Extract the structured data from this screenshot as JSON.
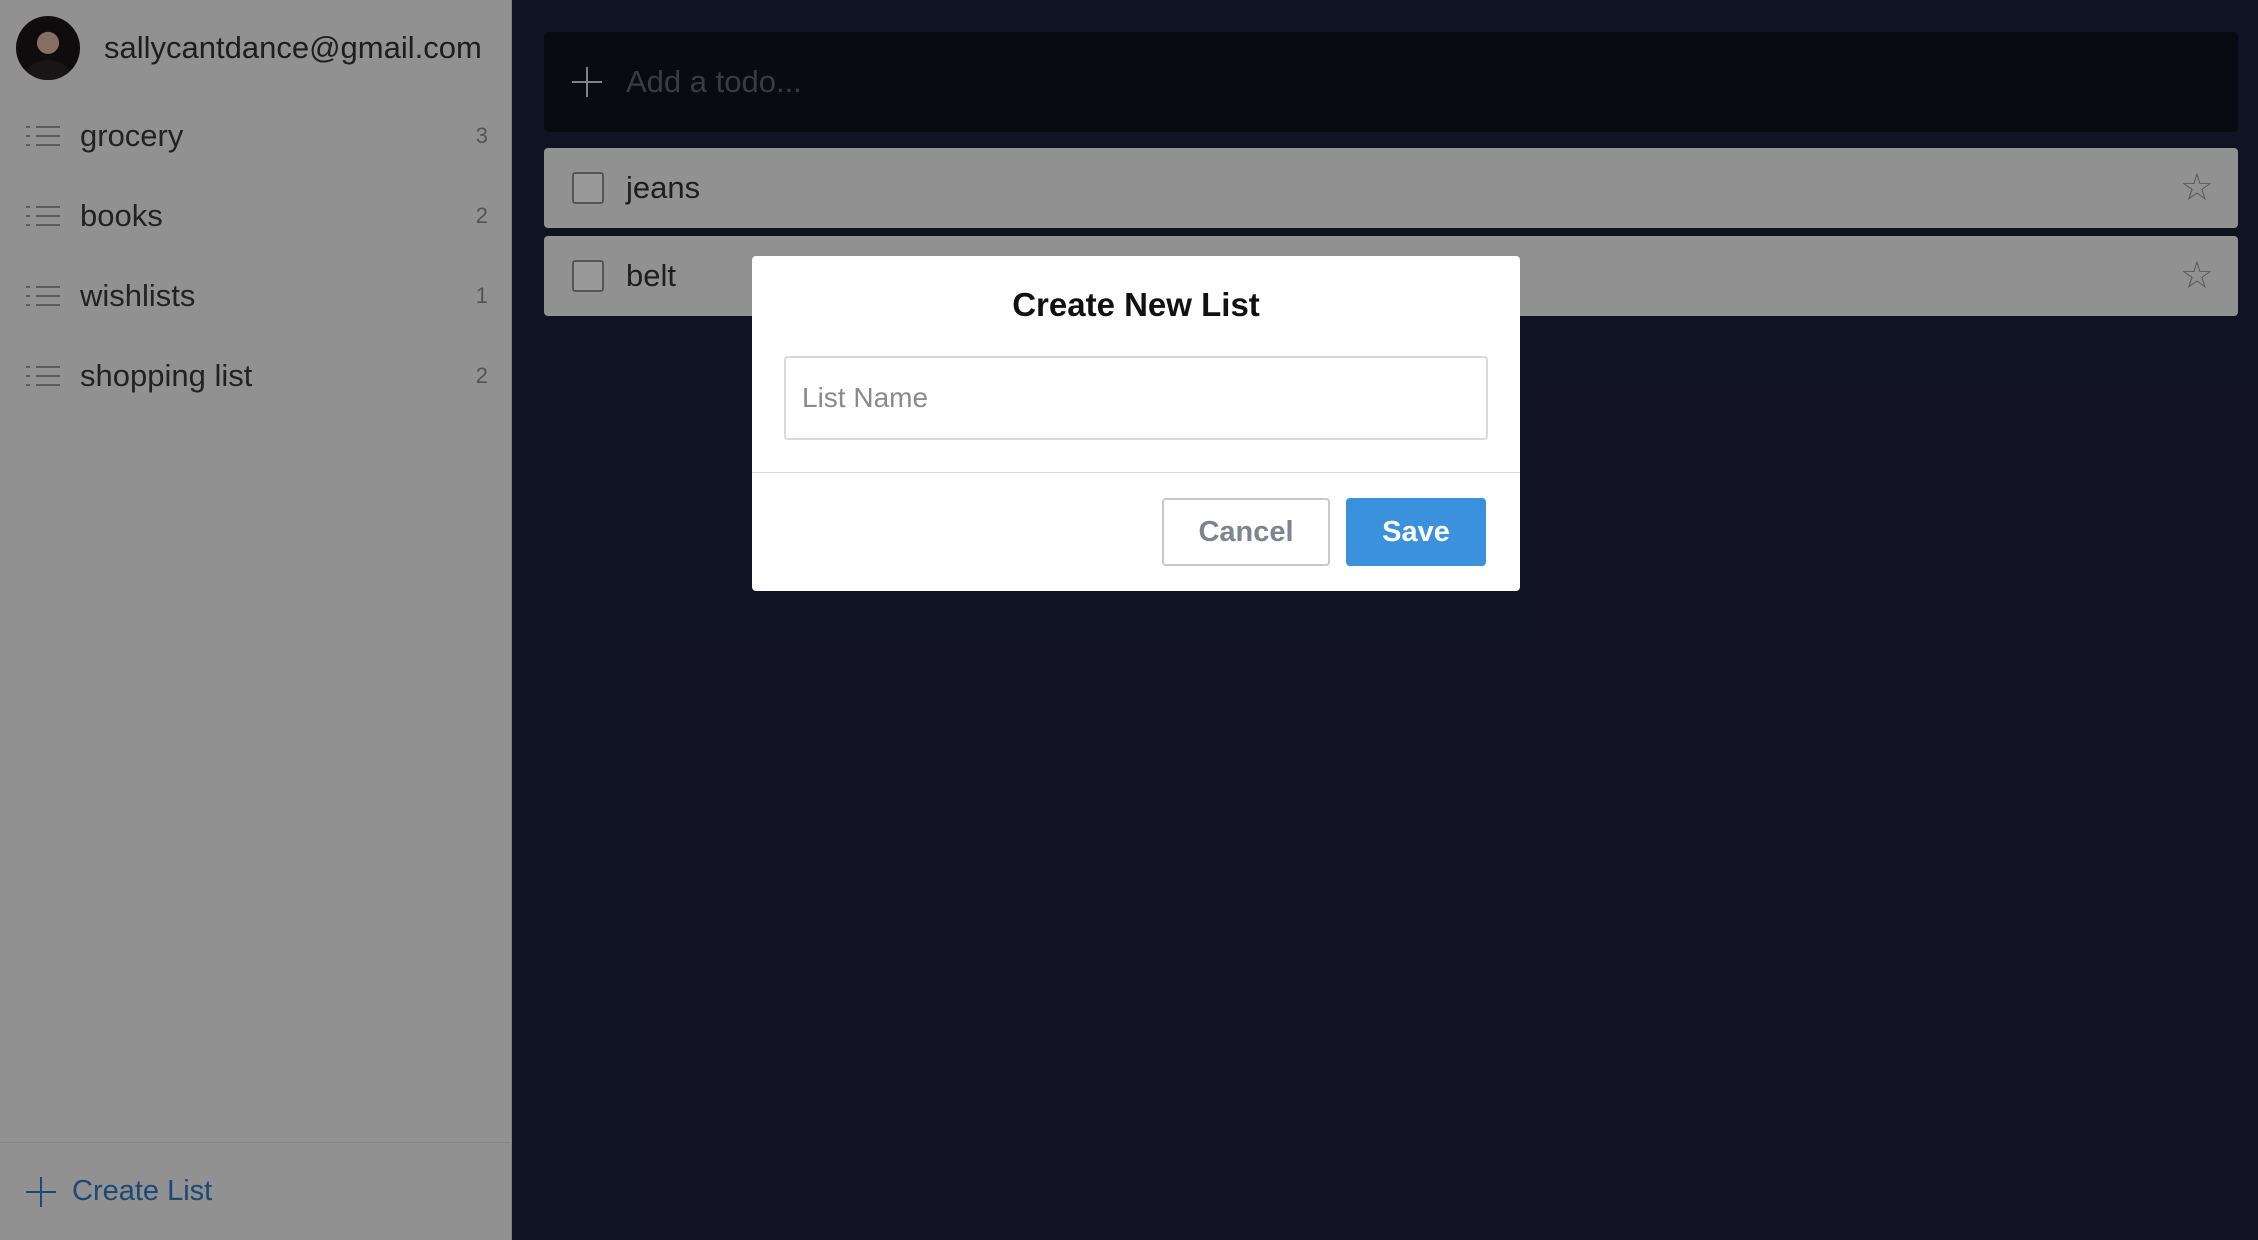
{
  "user": {
    "email": "sallycantdance@gmail.com"
  },
  "sidebar": {
    "lists": [
      {
        "label": "grocery",
        "count": "3"
      },
      {
        "label": "books",
        "count": "2"
      },
      {
        "label": "wishlists",
        "count": "1"
      },
      {
        "label": "shopping list",
        "count": "2"
      }
    ],
    "create_list_label": "Create List"
  },
  "main": {
    "add_todo_placeholder": "Add a todo...",
    "todos": [
      {
        "label": "jeans",
        "starred": false,
        "done": false
      },
      {
        "label": "belt",
        "starred": false,
        "done": false
      }
    ]
  },
  "modal": {
    "title": "Create New List",
    "input_placeholder": "List Name",
    "cancel_label": "Cancel",
    "save_label": "Save"
  },
  "colors": {
    "accent": "#3c91dd",
    "link": "#2f78c4",
    "background": "#1c2039",
    "sidebar": "#f2f2f2"
  }
}
